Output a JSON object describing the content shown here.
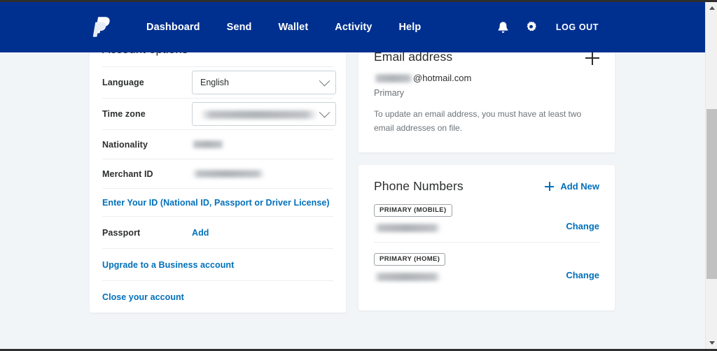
{
  "nav": {
    "logo_icon": "paypal-logo-icon",
    "links": [
      {
        "label": "Dashboard"
      },
      {
        "label": "Send"
      },
      {
        "label": "Wallet"
      },
      {
        "label": "Activity"
      },
      {
        "label": "Help"
      }
    ],
    "bell_icon": "notification-bell-icon",
    "gear_icon": "settings-gear-icon",
    "logout_label": "LOG OUT",
    "background_color": "#00308F"
  },
  "account_options": {
    "section_title": "Account options",
    "rows": [
      {
        "label": "Language",
        "type": "select",
        "value": "English",
        "redacted": false
      },
      {
        "label": "Time zone",
        "type": "select",
        "value": "",
        "redacted": true
      },
      {
        "label": "Nationality",
        "type": "text",
        "value": "",
        "redacted": true
      },
      {
        "label": "Merchant ID",
        "type": "text",
        "value": "",
        "redacted": true
      }
    ],
    "enter_id_link": "Enter Your ID (National ID, Passport or Driver License)",
    "passport_label": "Passport",
    "passport_add_link": "Add",
    "upgrade_link": "Upgrade to a Business account",
    "close_account_link": "Close your account",
    "link_color": "#0070BA"
  },
  "email_card": {
    "title": "Email address",
    "add_icon": "plus-icon",
    "address_suffix": "@hotmail.com",
    "address_redacted": true,
    "primary_label": "Primary",
    "note": "To update an email address, you must have at least two email addresses on file."
  },
  "phone_card": {
    "title": "Phone Numbers",
    "add_new_label": "Add New",
    "add_new_icon": "plus-icon",
    "rows": [
      {
        "tag": "PRIMARY (MOBILE)",
        "number_redacted": true,
        "action_label": "Change"
      },
      {
        "tag": "PRIMARY (HOME)",
        "number_redacted": true,
        "action_label": "Change"
      }
    ]
  },
  "scrollbar": {
    "up_arrow_icon": "scroll-up-arrow-icon",
    "down_arrow_icon": "scroll-down-arrow-icon"
  }
}
